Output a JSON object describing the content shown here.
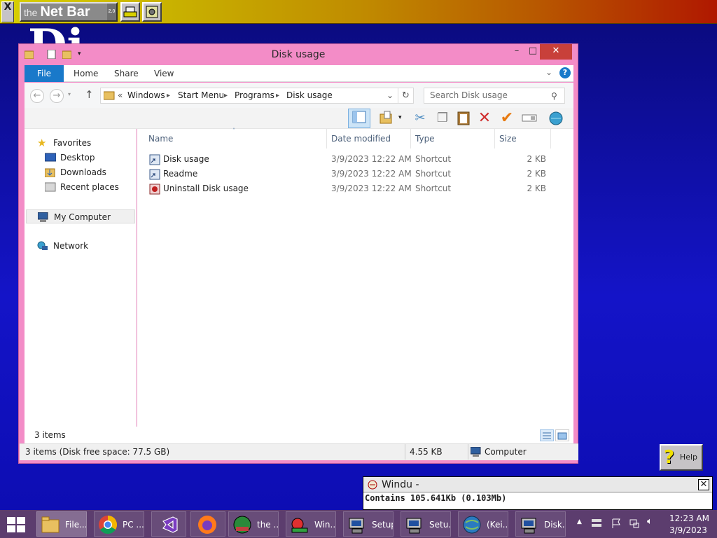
{
  "netbar": {
    "close_label": "X",
    "logo_the": "the",
    "logo_text": "Net Bar",
    "logo_version": "2.0"
  },
  "background": {
    "text": "Di"
  },
  "window": {
    "title": "Disk usage",
    "ribbon_tabs": [
      "File",
      "Home",
      "Share",
      "View"
    ],
    "breadcrumb": [
      "Windows",
      "Start Menu",
      "Programs",
      "Disk usage"
    ],
    "breadcrumb_overflow": "«",
    "search_placeholder": "Search Disk usage",
    "nav": {
      "favorites": "Favorites",
      "desktop": "Desktop",
      "downloads": "Downloads",
      "recent": "Recent places",
      "my_computer": "My Computer",
      "network": "Network"
    },
    "columns": [
      "Name",
      "Date modified",
      "Type",
      "Size"
    ],
    "files": [
      {
        "name": "Disk usage",
        "date": "3/9/2023 12:22 AM",
        "type": "Shortcut",
        "size": "2 KB",
        "icon": "shortcut-icon"
      },
      {
        "name": "Readme",
        "date": "3/9/2023 12:22 AM",
        "type": "Shortcut",
        "size": "2 KB",
        "icon": "shortcut-icon"
      },
      {
        "name": "Uninstall Disk usage",
        "date": "3/9/2023 12:22 AM",
        "type": "Shortcut",
        "size": "2 KB",
        "icon": "uninstall-icon"
      }
    ],
    "item_count": "3 items",
    "status_left": "3 items (Disk free space: 77.5 GB)",
    "status_size": "4.55 KB",
    "status_location": "Computer"
  },
  "help": {
    "label": "Help",
    "icon": "?"
  },
  "windu": {
    "title": "Windu -",
    "text": "Contains 105.641Kb (0.103Mb)"
  },
  "taskbar": {
    "items": [
      {
        "label": "File...",
        "icon": "file-explorer-icon"
      },
      {
        "label": "PC ...",
        "icon": "chrome-icon"
      },
      {
        "label": "",
        "icon": "visual-studio-icon"
      },
      {
        "label": "",
        "icon": "firefox-icon"
      },
      {
        "label": "the ...",
        "icon": "net-bar-icon"
      },
      {
        "label": "Win...",
        "icon": "windu-icon"
      },
      {
        "label": "Setup",
        "icon": "setup-icon"
      },
      {
        "label": "Setu...",
        "icon": "setup-icon"
      },
      {
        "label": "(Kei...",
        "icon": "globe-icon"
      },
      {
        "label": "Disk...",
        "icon": "disk-usage-icon"
      }
    ],
    "clock_time": "12:23 AM",
    "clock_date": "3/9/2023"
  },
  "colors": {
    "window_border": "#f38cc7",
    "file_tab": "#1979ca",
    "taskbar": "#5c3d6e"
  }
}
